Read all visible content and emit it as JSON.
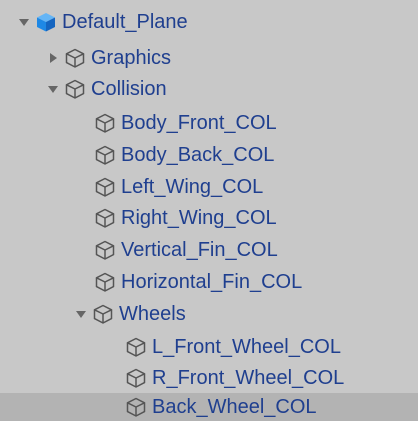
{
  "hierarchy": {
    "items": [
      {
        "label": "Default_Plane"
      },
      {
        "label": "Graphics"
      },
      {
        "label": "Collision"
      },
      {
        "label": "Body_Front_COL"
      },
      {
        "label": "Body_Back_COL"
      },
      {
        "label": "Left_Wing_COL"
      },
      {
        "label": "Right_Wing_COL"
      },
      {
        "label": "Vertical_Fin_COL"
      },
      {
        "label": "Horizontal_Fin_COL"
      },
      {
        "label": "Wheels"
      },
      {
        "label": "L_Front_Wheel_COL"
      },
      {
        "label": "R_Front_Wheel_COL"
      },
      {
        "label": "Back_Wheel_COL"
      }
    ]
  },
  "colors": {
    "background": "#c8c8c8",
    "selected_row": "#b3b3b3",
    "label_text": "#1f3f8f",
    "prefab_root_icon": "#1e88e5",
    "icon_outline": "#555555",
    "foldout_arrow": "#666666"
  },
  "icons": {
    "root": "prefab-cube-icon",
    "child": "gameobject-cube-icon",
    "expanded": "expanded-arrow-icon",
    "collapsed": "collapsed-arrow-icon"
  }
}
